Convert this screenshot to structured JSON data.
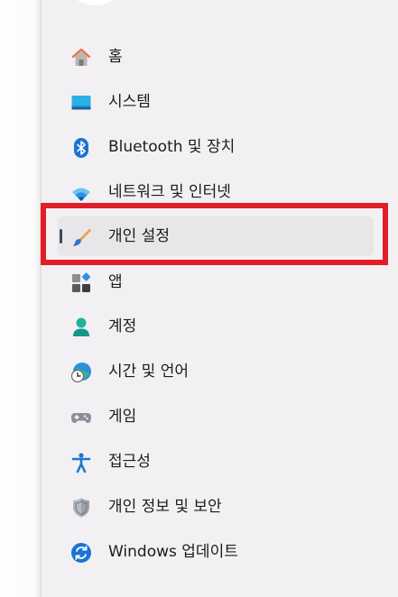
{
  "nav": {
    "items": [
      {
        "label": "홈",
        "icon": "home-icon"
      },
      {
        "label": "시스템",
        "icon": "system-icon"
      },
      {
        "label": "Bluetooth 및 장치",
        "icon": "bluetooth-icon"
      },
      {
        "label": "네트워크 및 인터넷",
        "icon": "wifi-icon"
      },
      {
        "label": "개인 설정",
        "icon": "brush-icon",
        "selected": true
      },
      {
        "label": "앱",
        "icon": "apps-icon"
      },
      {
        "label": "계정",
        "icon": "account-icon"
      },
      {
        "label": "시간 및 언어",
        "icon": "time-language-icon"
      },
      {
        "label": "게임",
        "icon": "gamepad-icon"
      },
      {
        "label": "접근성",
        "icon": "accessibility-icon"
      },
      {
        "label": "개인 정보 및 보안",
        "icon": "shield-icon"
      },
      {
        "label": "Windows 업데이트",
        "icon": "update-icon"
      }
    ]
  },
  "colors": {
    "panel_bg": "#f3f0f4",
    "selected_bg": "#e9e6ea",
    "indicator": "#2f4f5e",
    "highlight": "#e11e26"
  }
}
